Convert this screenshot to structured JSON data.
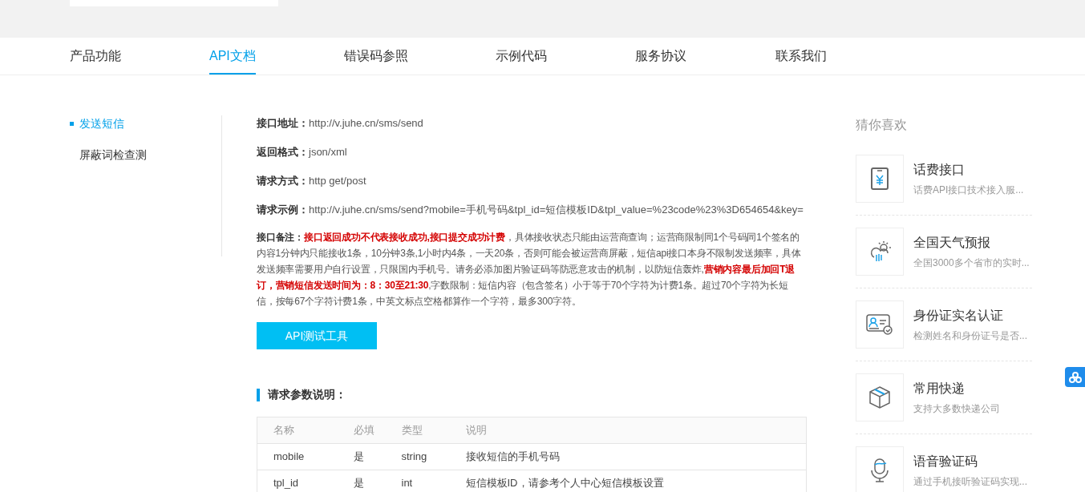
{
  "nav": {
    "tabs": [
      {
        "label": "产品功能",
        "selected": false
      },
      {
        "label": "API文档",
        "selected": true
      },
      {
        "label": "错误码参照",
        "selected": false
      },
      {
        "label": "示例代码",
        "selected": false
      },
      {
        "label": "服务协议",
        "selected": false
      },
      {
        "label": "联系我们",
        "selected": false
      }
    ]
  },
  "sidebar": {
    "items": [
      {
        "label": "发送短信",
        "selected": true
      },
      {
        "label": "屏蔽词检查测",
        "selected": false
      }
    ]
  },
  "fields": [
    {
      "label": "接口地址：",
      "value": "http://v.juhe.cn/sms/send"
    },
    {
      "label": "返回格式：",
      "value": "json/xml"
    },
    {
      "label": "请求方式：",
      "value": "http get/post"
    },
    {
      "label": "请求示例：",
      "value": "http://v.juhe.cn/sms/send?mobile=手机号码&tpl_id=短信模板ID&tpl_value=%23code%23%3D654654&key="
    }
  ],
  "note": {
    "label": "接口备注：",
    "segments": [
      {
        "kind": "highlight",
        "text": "接口返回成功不代表接收成功,接口提交成功计费"
      },
      {
        "kind": "normal",
        "text": "，具体接收状态只能由运营商查询；运营商限制同1个号码同1个签名的内容1分钟内只能接收1条，10分钟3条,1小时内4条，一天20条，否则可能会被运营商屏蔽，短信api接口本身不限制发送频率，具体发送频率需要用户自行设置，只限国内手机号。请务必添加图片验证码等防恶意攻击的机制，以防短信轰炸,"
      },
      {
        "kind": "highlight",
        "text": "营销内容最后加回T退订，营销短信发送时间为：8：30至21:30"
      },
      {
        "kind": "normal",
        "text": ",字数限制：短信内容（包含签名）小于等于70个字符为计费1条。超过70个字符为长短信，按每67个字符计费1条，中英文标点空格都算作一个字符，最多300字符。"
      }
    ]
  },
  "test_button": "API测试工具",
  "params": {
    "heading": "请求参数说明：",
    "columns": [
      "名称",
      "必填",
      "类型",
      "说明"
    ],
    "rows": [
      [
        "mobile",
        "是",
        "string",
        "接收短信的手机号码"
      ],
      [
        "tpl_id",
        "是",
        "int",
        "短信模板ID，请参考个人中心短信模板设置"
      ]
    ]
  },
  "recommend": {
    "title": "猜你喜欢",
    "items": [
      {
        "kind": "phone",
        "title": "话费接口",
        "desc": "话费API接口技术接入服..."
      },
      {
        "kind": "weather",
        "title": "全国天气预报",
        "desc": "全国3000多个省市的实时..."
      },
      {
        "kind": "idcard",
        "title": "身份证实名认证",
        "desc": "检测姓名和身份证号是否..."
      },
      {
        "kind": "parcel",
        "title": "常用快递",
        "desc": "支持大多数快递公司"
      },
      {
        "kind": "mic",
        "title": "语音验证码",
        "desc": "通过手机接听验证码实现..."
      }
    ]
  }
}
